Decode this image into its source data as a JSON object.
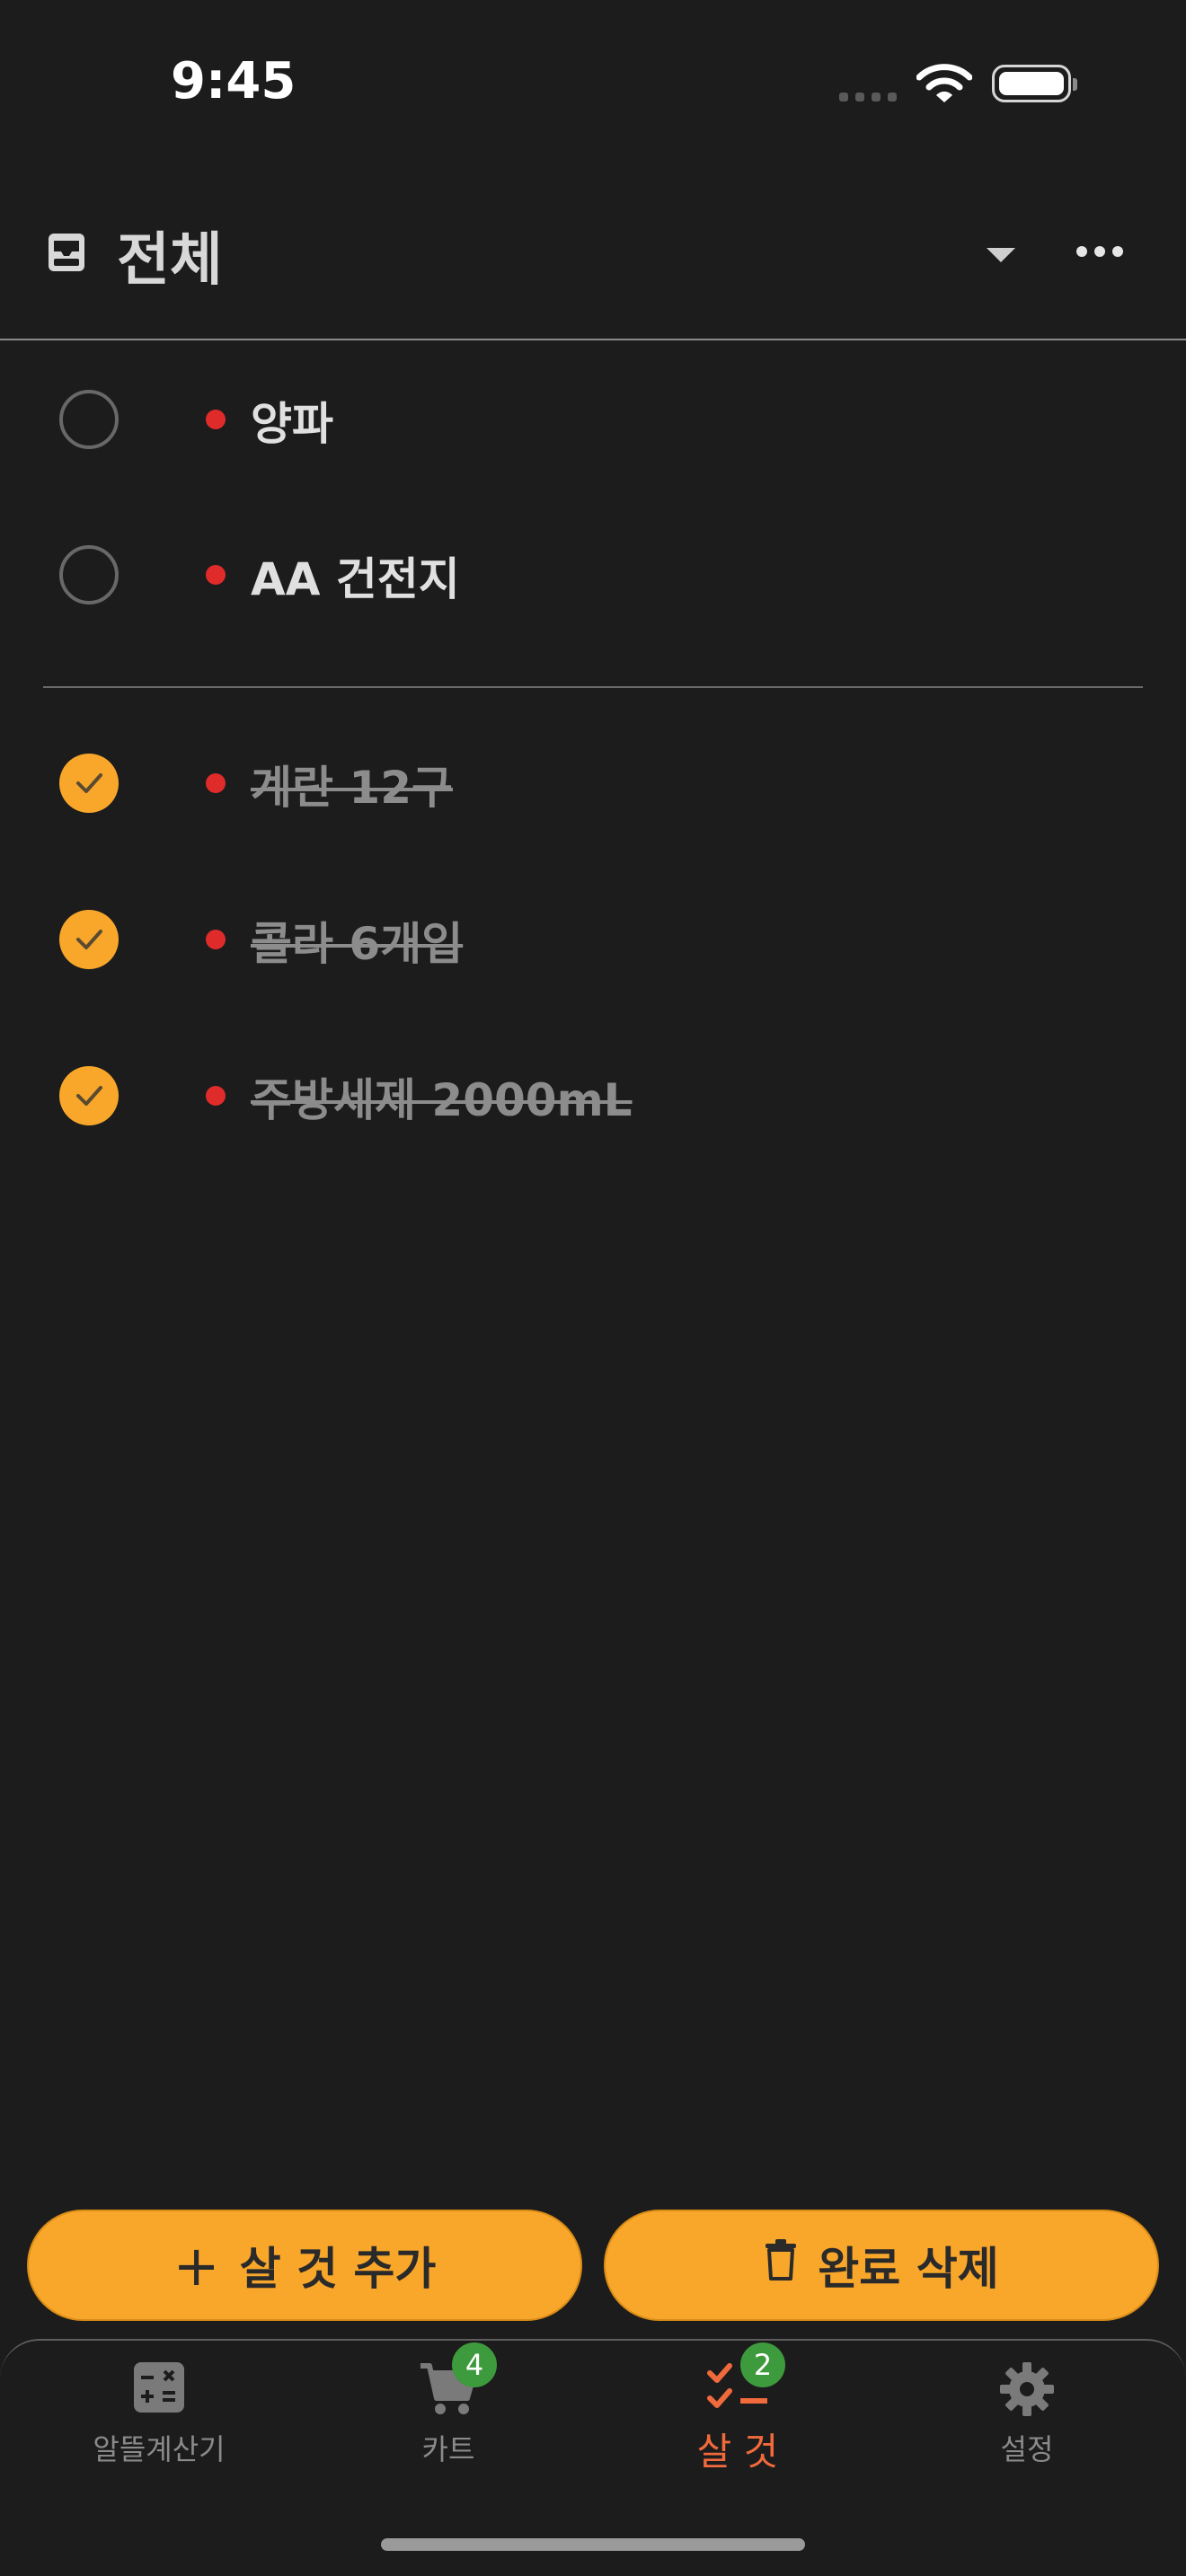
{
  "status_bar": {
    "time": "9:45"
  },
  "header": {
    "title": "전체"
  },
  "items_open": [
    {
      "label": "양파"
    },
    {
      "label": "AA 건전지"
    }
  ],
  "items_done": [
    {
      "label": "계란 12구"
    },
    {
      "label": "콜라 6개입"
    },
    {
      "label": "주방세제 2000mL"
    }
  ],
  "actions": {
    "add_label": "살 것 추가",
    "delete_done_label": "완료 삭제"
  },
  "tabbar": {
    "tabs": [
      {
        "label": "알뜰계산기",
        "icon": "calculator-icon"
      },
      {
        "label": "카트",
        "icon": "cart-icon",
        "badge": "4"
      },
      {
        "label": "살 것",
        "icon": "checklist-icon",
        "badge": "2",
        "active": true
      },
      {
        "label": "설정",
        "icon": "gear-icon"
      }
    ]
  },
  "colors": {
    "accent": "#f9a72b",
    "active_tab": "#f06a3c",
    "badge": "#3d9a3d",
    "dot": "#e02b2b",
    "background": "#1c1c1c"
  }
}
